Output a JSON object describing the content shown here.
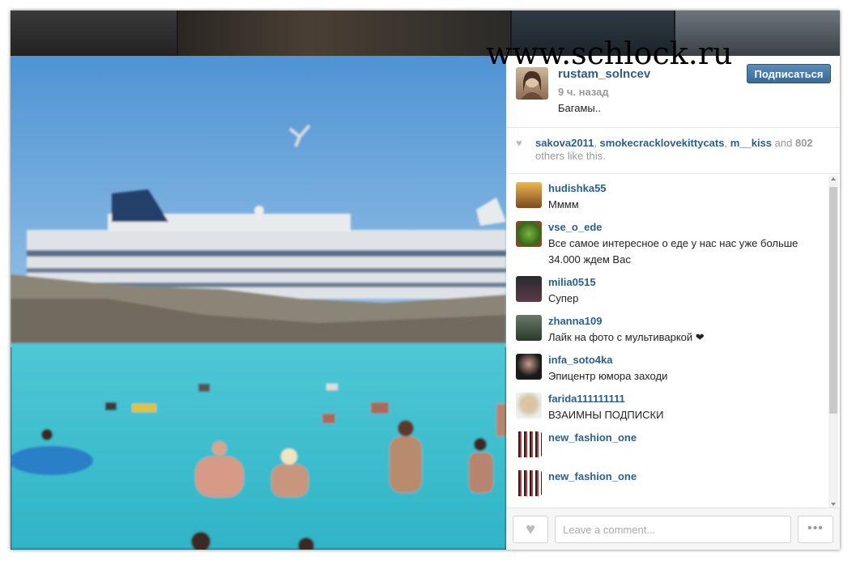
{
  "watermark": "www.schlock.ru",
  "post": {
    "username": "rustam_solncev",
    "time": "9 ч. назад",
    "caption": "Багамы..",
    "follow_label": "Подписаться"
  },
  "likes": {
    "users": [
      "sakova2011",
      "smokecracklovekittycats",
      "m__kiss"
    ],
    "sep1": ", ",
    "sep2": ", ",
    "and": " and ",
    "count": "802",
    "suffix": " others like this."
  },
  "comments": [
    {
      "user": "hudishka55",
      "text": "Мммм"
    },
    {
      "user": "vse_o_ede",
      "text": "Все самое интересное о еде у нас нас уже больше 34.000 ждем Вас"
    },
    {
      "user": "milia0515",
      "text": "Супер"
    },
    {
      "user": "zhanna109",
      "text": "Лайк на фото с мультиваркой ❤"
    },
    {
      "user": "infa_soto4ka",
      "text": "Эпицентр юмора заходи"
    },
    {
      "user": "farida111111111",
      "text": "ВЗАИМНЫ ПОДПИСКИ"
    },
    {
      "user": "new_fashion_one",
      "text": ""
    },
    {
      "user": "new_fashion_one",
      "text": ""
    }
  ],
  "footer": {
    "comment_placeholder": "Leave a comment...",
    "more_label": "•••",
    "heart_label": "♥"
  },
  "icons": {
    "heart": "heart-icon",
    "more": "more-dots-icon"
  }
}
